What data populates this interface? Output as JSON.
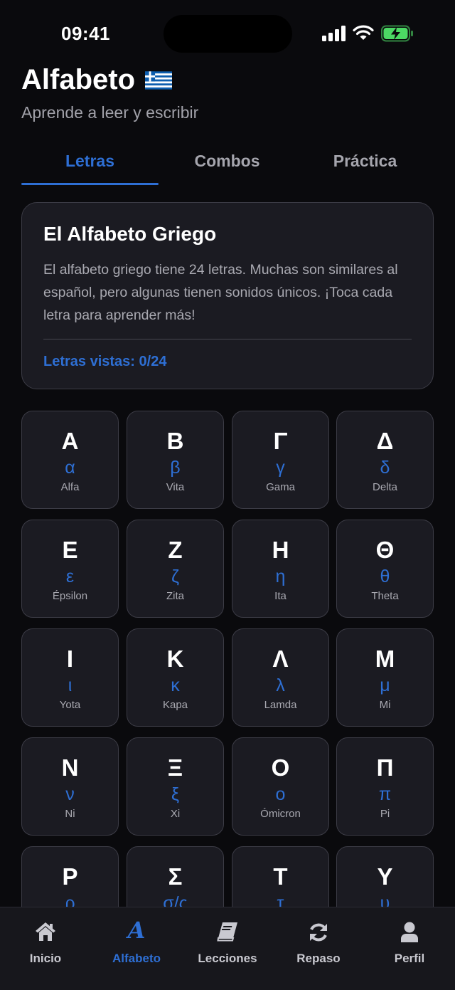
{
  "status_bar": {
    "time": "09:41"
  },
  "header": {
    "title": "Alfabeto",
    "subtitle": "Aprende a leer y escribir"
  },
  "tabs": [
    {
      "label": "Letras",
      "active": true
    },
    {
      "label": "Combos",
      "active": false
    },
    {
      "label": "Práctica",
      "active": false
    }
  ],
  "info_card": {
    "title": "El Alfabeto Griego",
    "text": "El alfabeto griego tiene 24 letras. Muchas son similares al español, pero algunas tienen sonidos únicos. ¡Toca cada letra para aprender más!",
    "letters_seen": "Letras vistas: 0/24"
  },
  "letters": [
    {
      "upper": "Α",
      "lower": "α",
      "name": "Alfa"
    },
    {
      "upper": "Β",
      "lower": "β",
      "name": "Vita"
    },
    {
      "upper": "Γ",
      "lower": "γ",
      "name": "Gama"
    },
    {
      "upper": "Δ",
      "lower": "δ",
      "name": "Delta"
    },
    {
      "upper": "Ε",
      "lower": "ε",
      "name": "Épsilon"
    },
    {
      "upper": "Ζ",
      "lower": "ζ",
      "name": "Zita"
    },
    {
      "upper": "Η",
      "lower": "η",
      "name": "Ita"
    },
    {
      "upper": "Θ",
      "lower": "θ",
      "name": "Theta"
    },
    {
      "upper": "Ι",
      "lower": "ι",
      "name": "Yota"
    },
    {
      "upper": "Κ",
      "lower": "κ",
      "name": "Kapa"
    },
    {
      "upper": "Λ",
      "lower": "λ",
      "name": "Lamda"
    },
    {
      "upper": "Μ",
      "lower": "μ",
      "name": "Mi"
    },
    {
      "upper": "Ν",
      "lower": "ν",
      "name": "Ni"
    },
    {
      "upper": "Ξ",
      "lower": "ξ",
      "name": "Xi"
    },
    {
      "upper": "Ο",
      "lower": "ο",
      "name": "Ómicron"
    },
    {
      "upper": "Π",
      "lower": "π",
      "name": "Pi"
    },
    {
      "upper": "Ρ",
      "lower": "ρ",
      "name": ""
    },
    {
      "upper": "Σ",
      "lower": "σ/ς",
      "name": ""
    },
    {
      "upper": "Τ",
      "lower": "τ",
      "name": ""
    },
    {
      "upper": "Υ",
      "lower": "υ",
      "name": ""
    }
  ],
  "nav": [
    {
      "label": "Inicio",
      "icon": "home-icon",
      "active": false
    },
    {
      "label": "Alfabeto",
      "icon": "alpha-icon",
      "active": true
    },
    {
      "label": "Lecciones",
      "icon": "book-icon",
      "active": false
    },
    {
      "label": "Repaso",
      "icon": "refresh-icon",
      "active": false
    },
    {
      "label": "Perfil",
      "icon": "user-icon",
      "active": false
    }
  ],
  "colors": {
    "accent": "#2e6fd4",
    "background": "#0a0a0d",
    "card": "#1b1b22",
    "battery": "#4cd964"
  }
}
